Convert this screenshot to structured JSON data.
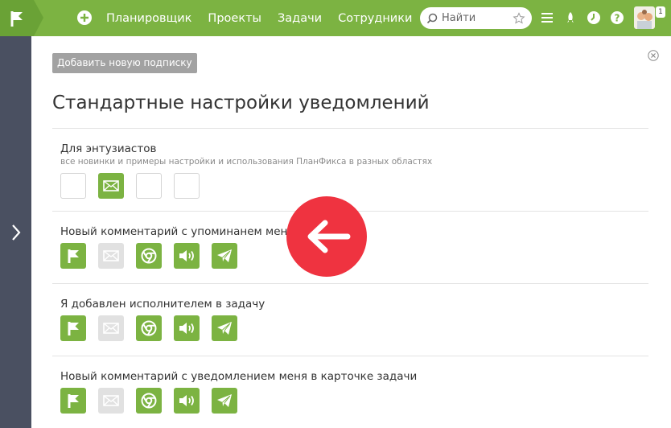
{
  "header": {
    "nav": [
      "Планировщик",
      "Проекты",
      "Задачи",
      "Сотрудники"
    ],
    "search_placeholder": "Найти",
    "badge_count": "1",
    "color": "#7cb342"
  },
  "page": {
    "add_subscription_label": "Добавить новую подписку",
    "title": "Стандартные настройки уведомлений"
  },
  "sections": [
    {
      "title": "Для энтузиастов",
      "subtitle": "все новинки и примеры настройки и использования ПланФикса в разных областях",
      "channels": [
        {
          "name": "planfix",
          "state": "empty"
        },
        {
          "name": "email",
          "state": "on"
        },
        {
          "name": "browser",
          "state": "empty"
        },
        {
          "name": "sound",
          "state": "empty"
        }
      ]
    },
    {
      "title": "Новый комментарий с упоминанем меня",
      "channels": [
        {
          "name": "planfix",
          "state": "on"
        },
        {
          "name": "email",
          "state": "off"
        },
        {
          "name": "browser",
          "state": "on"
        },
        {
          "name": "sound",
          "state": "on"
        },
        {
          "name": "telegram",
          "state": "on"
        }
      ]
    },
    {
      "title": "Я добавлен исполнителем в задачу",
      "channels": [
        {
          "name": "planfix",
          "state": "on"
        },
        {
          "name": "email",
          "state": "off"
        },
        {
          "name": "browser",
          "state": "on"
        },
        {
          "name": "sound",
          "state": "on"
        },
        {
          "name": "telegram",
          "state": "on"
        }
      ]
    },
    {
      "title": "Новый комментарий с уведомлением меня в карточке задачи",
      "channels": [
        {
          "name": "planfix",
          "state": "on"
        },
        {
          "name": "email",
          "state": "off"
        },
        {
          "name": "browser",
          "state": "on"
        },
        {
          "name": "sound",
          "state": "on"
        },
        {
          "name": "telegram",
          "state": "on"
        }
      ]
    }
  ]
}
